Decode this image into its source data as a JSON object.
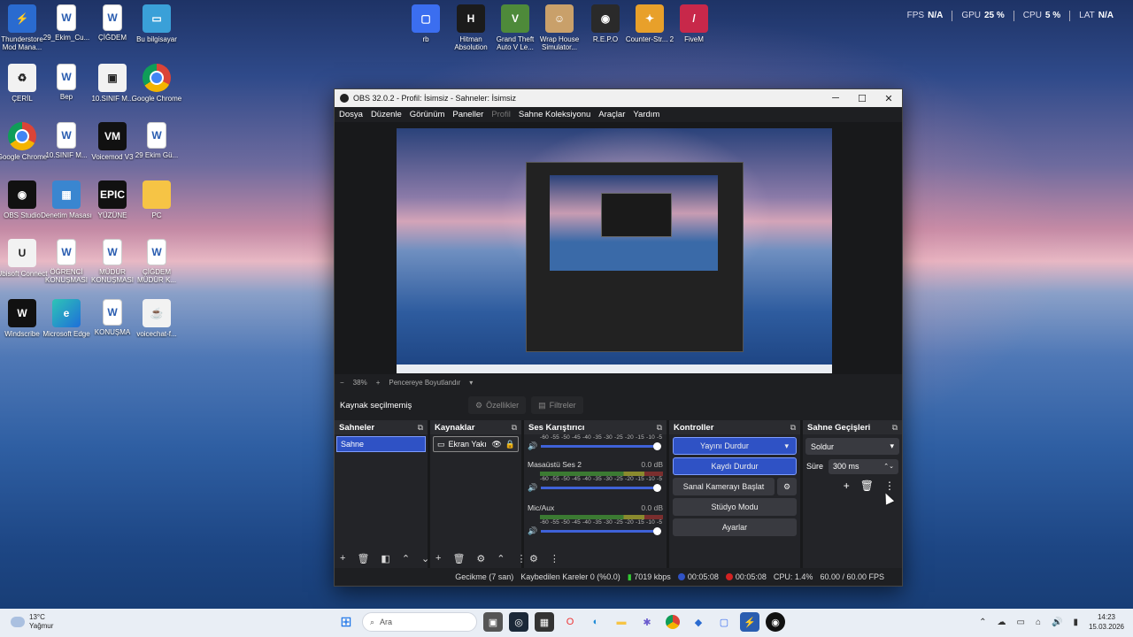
{
  "desktop_icons": [
    {
      "label": "Thunderstore Mod Mana...",
      "icon": "thunderstore-icon",
      "color": "#2a6bd0"
    },
    {
      "label": "29_Ekim_Cu...",
      "icon": "document-icon"
    },
    {
      "label": "ÇİĞDEM",
      "icon": "word-document-icon"
    },
    {
      "label": "Bu bilgisayar",
      "icon": "computer-icon",
      "color": "#3aa0d8"
    },
    {
      "label": "ÇERİL",
      "icon": "recycle-bin-icon"
    },
    {
      "label": "Bep",
      "icon": "word-document-icon"
    },
    {
      "label": "10.SINIF M...",
      "icon": "app-icon"
    },
    {
      "label": "Google Chrome",
      "icon": "chrome-icon"
    },
    {
      "label": "Google Chrome",
      "icon": "chrome-icon"
    },
    {
      "label": "10.SINIF M...",
      "icon": "word-document-icon"
    },
    {
      "label": "Voicemod V3",
      "icon": "voicemod-icon"
    },
    {
      "label": "29 Ekim Gü...",
      "icon": "document-icon"
    },
    {
      "label": "OBS Studio",
      "icon": "obs-icon"
    },
    {
      "label": "Denetim Masası",
      "icon": "control-panel-icon"
    },
    {
      "label": "YÜZÜNE",
      "icon": "epic-games-icon"
    },
    {
      "label": "PC",
      "icon": "folder-icon"
    },
    {
      "label": "Ubisoft Connect",
      "icon": "ubisoft-icon"
    },
    {
      "label": "ÖĞRENCİ KONUŞMASI",
      "icon": "word-document-icon"
    },
    {
      "label": "MÜDÜR KONUŞMASI",
      "icon": "word-document-icon"
    },
    {
      "label": "ÇİĞDEM MÜDÜR K...",
      "icon": "word-document-icon"
    },
    {
      "label": "Windscribe",
      "icon": "windscribe-icon"
    },
    {
      "label": "Microsoft Edge",
      "icon": "edge-icon"
    },
    {
      "label": "KONUŞMA",
      "icon": "word-document-icon"
    },
    {
      "label": "voicechat-f...",
      "icon": "java-icon"
    }
  ],
  "top_icons": [
    {
      "label": "rb",
      "icon": "roblox-icon",
      "color": "#3b6ef0",
      "glyph": "▢"
    },
    {
      "label": "Hitman Absolution",
      "icon": "hitman-icon",
      "color": "#1b1b1b",
      "glyph": "H"
    },
    {
      "label": "Grand Theft Auto V Le...",
      "icon": "gta-icon",
      "color": "#4e8a3a",
      "glyph": "V"
    },
    {
      "label": "Wrap House Simulator...",
      "icon": "wrap-house-icon",
      "color": "#c9a06a",
      "glyph": "☺"
    },
    {
      "label": "R.E.P.O",
      "icon": "repo-icon",
      "color": "#2a2a2a",
      "glyph": "◉"
    },
    {
      "label": "Counter-Str... 2",
      "icon": "counter-strike-icon",
      "color": "#e8a02a",
      "glyph": "✦"
    },
    {
      "label": "FiveM",
      "icon": "fivem-icon",
      "color": "#c8284a",
      "glyph": "/"
    }
  ],
  "stats": [
    {
      "label": "FPS",
      "value": "N/A"
    },
    {
      "label": "GPU",
      "value": "25 %"
    },
    {
      "label": "CPU",
      "value": "5 %"
    },
    {
      "label": "LAT",
      "value": "N/A"
    }
  ],
  "obs": {
    "title": "OBS 32.0.2 - Profil: İsimsiz - Sahneler: İsimsiz",
    "menu": [
      "Dosya",
      "Düzenle",
      "Görünüm",
      "Paneller",
      "Profil",
      "Sahne Koleksiyonu",
      "Araçlar",
      "Yardım"
    ],
    "zoom": {
      "minus": "−",
      "value": "38%",
      "plus": "+",
      "fit": "Pencereye Boyutlandır"
    },
    "source_bar": {
      "label": "Kaynak seçilmemiş",
      "properties": "Özellikler",
      "filters": "Filtreler"
    },
    "scenes": {
      "title": "Sahneler",
      "items": [
        "Sahne"
      ]
    },
    "sources": {
      "title": "Kaynaklar",
      "items": [
        "Ekran Yakı"
      ]
    },
    "mixer": {
      "title": "Ses Karıştırıcı",
      "ticks": "-60 -55 -50 -45 -40 -35 -30 -25 -20 -15 -10 -5 0",
      "channels": [
        {
          "name": "",
          "db": ""
        },
        {
          "name": "Masaüstü Ses 2",
          "db": "0.0 dB"
        },
        {
          "name": "Mic/Aux",
          "db": "0.0 dB"
        }
      ]
    },
    "controls": {
      "title": "Kontroller",
      "stop_stream": "Yayını Durdur",
      "stop_record": "Kaydı Durdur",
      "virtual_cam": "Sanal Kamerayı Başlat",
      "studio_mode": "Stüdyo Modu",
      "settings": "Ayarlar"
    },
    "transitions": {
      "title": "Sahne Geçişleri",
      "selected": "Soldur",
      "duration_label": "Süre",
      "duration_value": "300 ms"
    },
    "status": {
      "delay": "Gecikme (7 san)",
      "dropped": "Kaybedilen Kareler 0 (%0.0)",
      "bitrate": "7019 kbps",
      "stream_time": "00:05:08",
      "rec_time": "00:05:08",
      "cpu": "CPU: 1.4%",
      "fps": "60.00 / 60.00 FPS"
    }
  },
  "taskbar": {
    "weather_temp": "13°C",
    "weather_desc": "Yağmur",
    "search_placeholder": "Ara",
    "time": "14:23",
    "date": "15.03.2026"
  },
  "colors": {
    "accent": "#2f52c5",
    "obs_bg": "#1e1f22",
    "record_red": "#d32222"
  }
}
